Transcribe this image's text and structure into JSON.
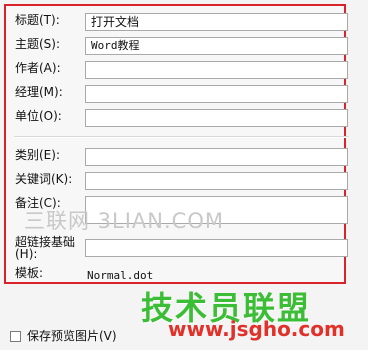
{
  "fields": [
    {
      "label": "标题(T):",
      "value": "打开文档"
    },
    {
      "label": "主题(S):",
      "value": "Word教程"
    },
    {
      "label": "作者(A):",
      "value": ""
    },
    {
      "label": "经理(M):",
      "value": ""
    },
    {
      "label": "单位(O):",
      "value": ""
    },
    {
      "label": "类别(E):",
      "value": ""
    },
    {
      "label": "关键词(K):",
      "value": ""
    },
    {
      "label": "备注(C):",
      "value": ""
    },
    {
      "label": "超链接基础(H):",
      "value": ""
    }
  ],
  "template": {
    "label": "模板:",
    "value": "Normal.dot"
  },
  "save_preview": {
    "label": "保存预览图片(V)",
    "checked": false
  },
  "watermark_text": "三联网 3LIAN.COM",
  "brand_text": "技术员联盟",
  "brand_url": "www.jsgho.com",
  "colors": {
    "highlight_border": "#d8232a",
    "brand_green": "#3bbd35",
    "brand_red": "#e0322a"
  }
}
